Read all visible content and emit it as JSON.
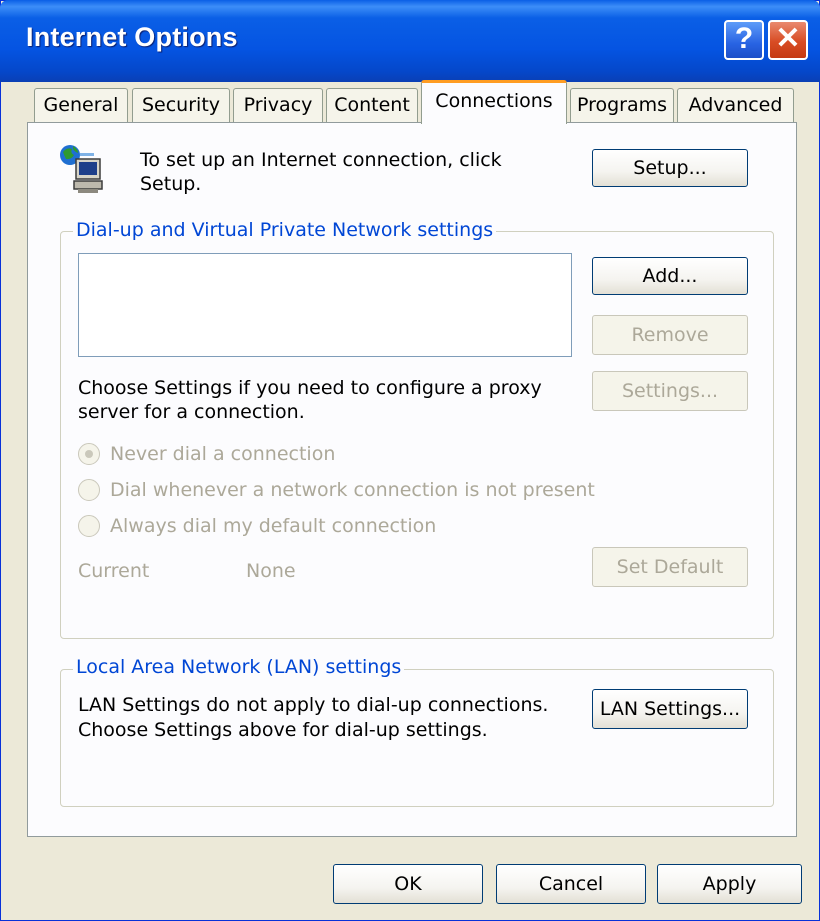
{
  "window": {
    "title": "Internet Options",
    "help_glyph": "?",
    "close_glyph": "✕"
  },
  "tabs": [
    {
      "label": "General"
    },
    {
      "label": "Security"
    },
    {
      "label": "Privacy"
    },
    {
      "label": "Content"
    },
    {
      "label": "Connections",
      "active": true
    },
    {
      "label": "Programs"
    },
    {
      "label": "Advanced"
    }
  ],
  "setup": {
    "text_line1": "To set up an Internet connection, click",
    "text_line2": "Setup.",
    "button": "Setup..."
  },
  "dialup": {
    "legend": "Dial-up and Virtual Private Network settings",
    "add": "Add...",
    "remove": "Remove",
    "settings": "Settings...",
    "proxy_line1": "Choose Settings if you need to configure a proxy",
    "proxy_line2": "server for a connection.",
    "radios": [
      {
        "label": "Never dial a connection",
        "selected": true
      },
      {
        "label": "Dial whenever a network connection is not present",
        "selected": false
      },
      {
        "label": "Always dial my default connection",
        "selected": false
      }
    ],
    "current_label": "Current",
    "current_value": "None",
    "set_default": "Set Default"
  },
  "lan": {
    "legend": "Local Area Network (LAN) settings",
    "line1": "LAN Settings do not apply to dial-up connections.",
    "line2": "Choose Settings above for dial-up settings.",
    "button": "LAN Settings..."
  },
  "footer": {
    "ok": "OK",
    "cancel": "Cancel",
    "apply": "Apply"
  },
  "colors": {
    "titlebar": "#0a5fe6",
    "dialog_bg": "#ece9d8",
    "group_label": "#0046d5",
    "active_tab_accent": "#ff9d23",
    "disabled_text": "#aca899"
  }
}
